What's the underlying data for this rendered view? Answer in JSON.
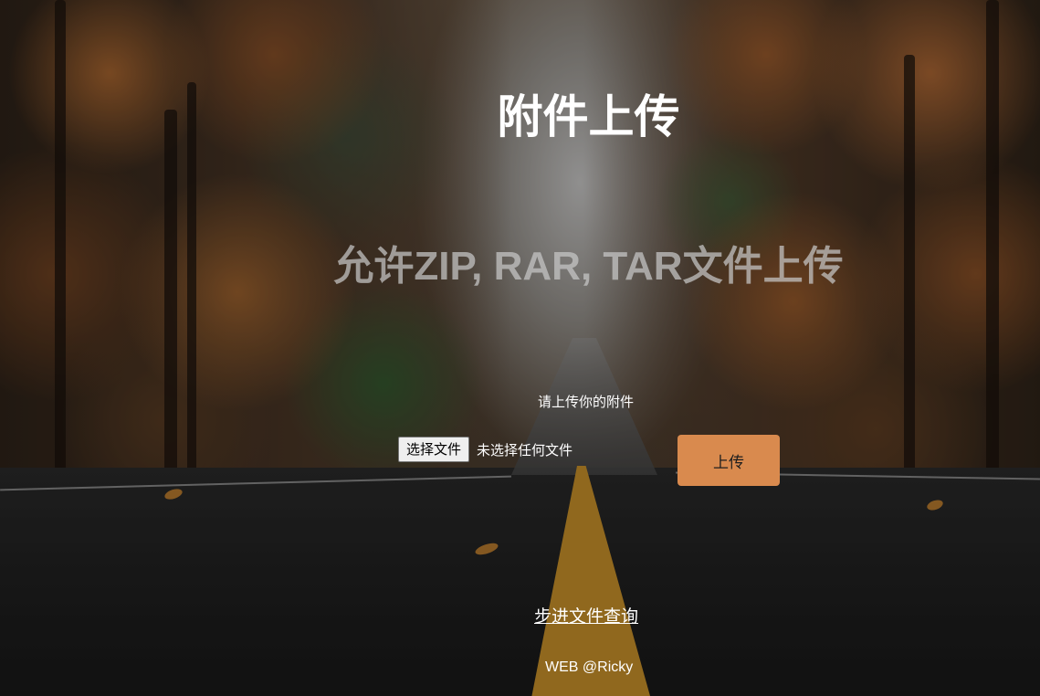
{
  "header": {
    "title": "附件上传",
    "subtitle": "允许ZIP, RAR, TAR文件上传"
  },
  "upload": {
    "prompt": "请上传你的附件",
    "choose_file_label": "选择文件",
    "no_file_text": "未选择任何文件",
    "submit_label": "上传",
    "submit_color": "#d98a4e"
  },
  "links": {
    "query_label": "步进文件查询"
  },
  "footer": {
    "text": "WEB @Ricky"
  }
}
